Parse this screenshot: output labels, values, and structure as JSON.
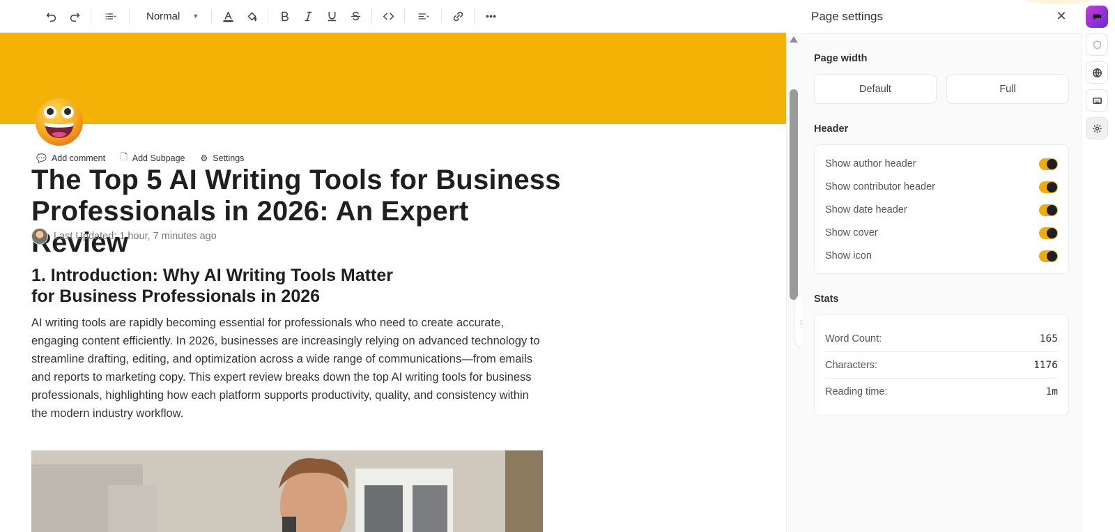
{
  "toolbar": {
    "style_label": "Normal",
    "icons": [
      "undo-icon",
      "redo-icon",
      "list-icon",
      "text-color-icon",
      "highlight-icon",
      "bold-icon",
      "italic-icon",
      "underline-icon",
      "strikethrough-icon",
      "code-icon",
      "align-icon",
      "link-icon",
      "more-icon"
    ]
  },
  "cover": {
    "color": "#f4b106"
  },
  "doc": {
    "actions": {
      "comment": "Add comment",
      "subpage": "Add Subpage",
      "settings": "Settings"
    },
    "title": "The Top 5 AI Writing Tools for Business Professionals in 2026: An Expert Review",
    "updated": "Last Updated: 1 hour, 7 minutes ago",
    "heading": "1. Introduction: Why AI Writing Tools Matter for Business Professionals in 2026",
    "paragraph": "AI writing tools are rapidly becoming essential for professionals who need to create accurate, engaging content efficiently. In 2026, businesses are increasingly relying on advanced technology to streamline drafting, editing, and optimization across a wide range of communications—from emails and reports to marketing copy. This expert review breaks down the top AI writing tools for business professionals, highlighting how each platform supports productivity, quality, and consistency within the modern industry workflow."
  },
  "panel": {
    "title": "Page settings",
    "page_width": {
      "label": "Page width",
      "options": [
        "Default",
        "Full"
      ]
    },
    "header": {
      "label": "Header",
      "toggles": [
        {
          "label": "Show author header",
          "on": true
        },
        {
          "label": "Show contributor header",
          "on": true
        },
        {
          "label": "Show date header",
          "on": true
        },
        {
          "label": "Show cover",
          "on": true
        },
        {
          "label": "Show icon",
          "on": true
        }
      ]
    },
    "stats": {
      "label": "Stats",
      "items": [
        {
          "label": "Word Count:",
          "value": "165"
        },
        {
          "label": "Characters:",
          "value": "1176"
        },
        {
          "label": "Reading time:",
          "value": "1m"
        }
      ]
    }
  },
  "rail": {
    "icons": [
      "app-icon",
      "shield-icon",
      "globe-icon",
      "keyboard-icon",
      "gear-icon"
    ],
    "accent": "#f0ab0b"
  }
}
